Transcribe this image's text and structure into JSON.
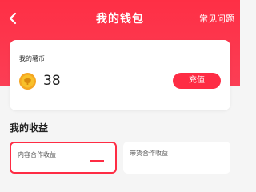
{
  "colors": {
    "brand": "#fe2c44",
    "header_top": "#fe2f45",
    "page_bg": "#f5f5f5"
  },
  "header": {
    "title": "我的钱包",
    "faq_link": "常见问题",
    "back_icon": "chevron-left-icon"
  },
  "wallet": {
    "label": "我的薯币",
    "balance": "38",
    "coin_icon": "coin-icon",
    "recharge_label": "充值"
  },
  "income": {
    "section_title": "我的收益",
    "cards": [
      {
        "label": "内容合作收益",
        "selected": true
      },
      {
        "label": "带货合作收益",
        "selected": false
      }
    ]
  }
}
